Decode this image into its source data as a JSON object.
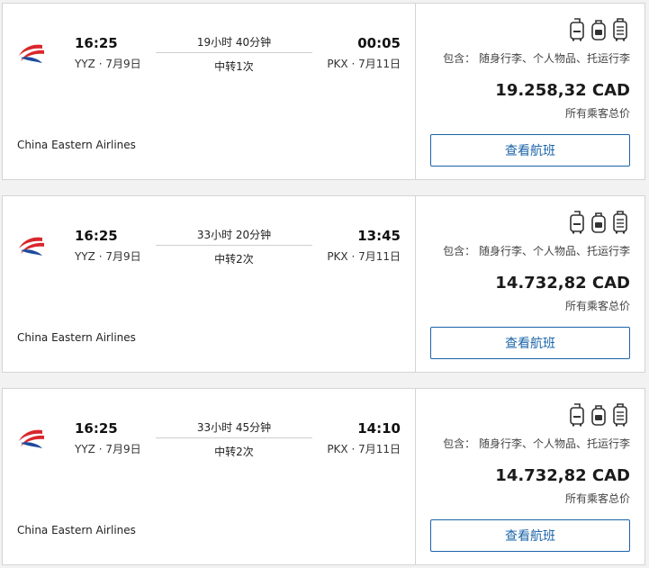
{
  "colors": {
    "accent": "#1a64a8",
    "logo_red": "#d9262c",
    "logo_blue": "#1d4a9c",
    "border": "#d4d4d4"
  },
  "icons": [
    "carry-on-bag-icon",
    "personal-item-icon",
    "checked-bag-icon"
  ],
  "flights": [
    {
      "airline": "China Eastern Airlines",
      "dep_time": "16:25",
      "dep_place": "YYZ · 7月9日",
      "duration": "19小时 40分钟",
      "stops": "中转1次",
      "arr_time": "00:05",
      "arr_place": "PKX · 7月11日",
      "includes": "包含： 随身行李、个人物品、托运行李",
      "price": "19.258,32 CAD",
      "price_note": "所有乘客总价",
      "button_label": "查看航班"
    },
    {
      "airline": "China Eastern Airlines",
      "dep_time": "16:25",
      "dep_place": "YYZ · 7月9日",
      "duration": "33小时 20分钟",
      "stops": "中转2次",
      "arr_time": "13:45",
      "arr_place": "PKX · 7月11日",
      "includes": "包含： 随身行李、个人物品、托运行李",
      "price": "14.732,82 CAD",
      "price_note": "所有乘客总价",
      "button_label": "查看航班"
    },
    {
      "airline": "China Eastern Airlines",
      "dep_time": "16:25",
      "dep_place": "YYZ · 7月9日",
      "duration": "33小时 45分钟",
      "stops": "中转2次",
      "arr_time": "14:10",
      "arr_place": "PKX · 7月11日",
      "includes": "包含： 随身行李、个人物品、托运行李",
      "price": "14.732,82 CAD",
      "price_note": "所有乘客总价",
      "button_label": "查看航班"
    }
  ]
}
